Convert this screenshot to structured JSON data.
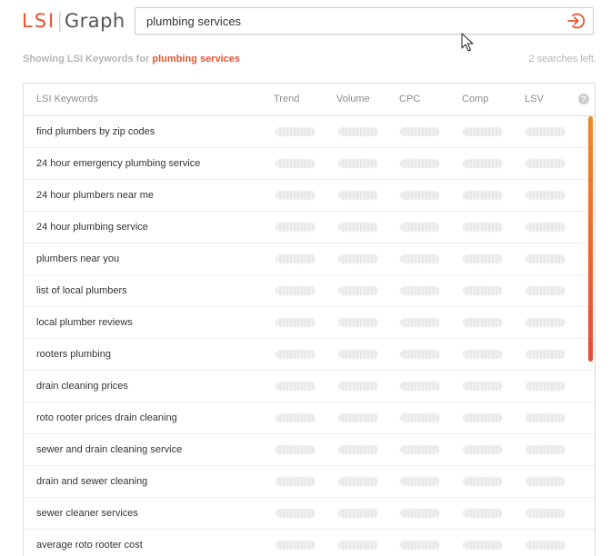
{
  "logo": {
    "part1": "LSI",
    "part2": "Graph"
  },
  "search": {
    "value": "plumbing services"
  },
  "info": {
    "prefix": "Showing LSI Keywords for ",
    "keyword": "plumbing services",
    "searches_left": "2 searches left."
  },
  "table": {
    "headers": {
      "keywords": "LSI Keywords",
      "trend": "Trend",
      "volume": "Volume",
      "cpc": "CPC",
      "comp": "Comp",
      "lsv": "LSV"
    },
    "rows": [
      "find plumbers by zip codes",
      "24 hour emergency plumbing service",
      "24 hour plumbers near me",
      "24 hour plumbing service",
      "plumbers near you",
      "list of local plumbers",
      "local plumber reviews",
      "rooters plumbing",
      "drain cleaning prices",
      "roto rooter prices drain cleaning",
      "sewer and drain cleaning service",
      "drain and sewer cleaning",
      "sewer cleaner services",
      "average roto rooter cost"
    ]
  },
  "colors": {
    "accent": "#e8532f",
    "scrollbar_top": "#f08a2a",
    "scrollbar_bottom": "#ea4a37"
  },
  "icons": {
    "submit": "arrow-in-circle-icon",
    "help": "question-circle-icon",
    "cursor": "mouse-pointer-icon"
  }
}
